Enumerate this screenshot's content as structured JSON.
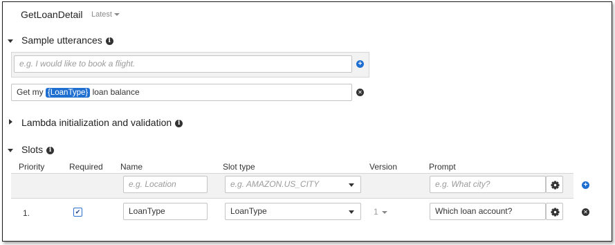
{
  "header": {
    "intent_name": "GetLoanDetail",
    "version_label": "Latest"
  },
  "sample_utterances": {
    "title": "Sample utterances",
    "placeholder": "e.g. I would like to book a flight.",
    "items": [
      {
        "before": "Get my",
        "slot": "{LoanType}",
        "after": "loan balance"
      }
    ]
  },
  "lambda_section": {
    "title": "Lambda initialization and validation"
  },
  "slots": {
    "title": "Slots",
    "columns": {
      "priority": "Priority",
      "required": "Required",
      "name": "Name",
      "slot_type": "Slot type",
      "version": "Version",
      "prompt": "Prompt"
    },
    "new_row": {
      "name_placeholder": "e.g. Location",
      "type_placeholder": "e.g. AMAZON.US_CITY",
      "prompt_placeholder": "e.g. What city?"
    },
    "rows": [
      {
        "priority": "1.",
        "required": true,
        "name": "LoanType",
        "slot_type": "LoanType",
        "version": "1",
        "prompt": "Which loan account?"
      }
    ]
  },
  "icons": {
    "info": "info-icon",
    "add": "plus-circle-icon",
    "remove": "x-circle-icon",
    "settings": "gear-icon"
  },
  "colors": {
    "accent": "#1f6fd1"
  }
}
